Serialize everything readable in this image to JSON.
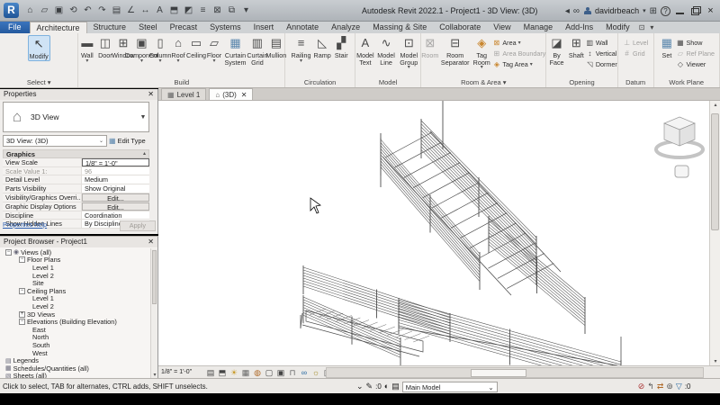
{
  "title_bar": {
    "title": "Autodesk Revit 2022.1 - Project1 - 3D View: (3D)",
    "user": "davidrbeach",
    "qat_icons": [
      "home",
      "open",
      "save",
      "sync-with-central",
      "undo",
      "redo",
      "print",
      "measure",
      "aligned-dimension",
      "text",
      "default-3d-view",
      "section",
      "thin-lines",
      "close-inactive-windows",
      "switch-windows",
      "customize-qat"
    ]
  },
  "ribbon_tabs": {
    "file": "File",
    "tabs": [
      "Architecture",
      "Structure",
      "Steel",
      "Precast",
      "Systems",
      "Insert",
      "Annotate",
      "Analyze",
      "Massing & Site",
      "Collaborate",
      "View",
      "Manage",
      "Add-Ins",
      "Modify"
    ],
    "active": "Architecture"
  },
  "ribbon": {
    "panels": [
      {
        "name": "Select",
        "arrow": true,
        "items": [
          {
            "label": "Modify",
            "icon": "modify-cursor",
            "size": "big",
            "selected": true
          }
        ]
      },
      {
        "name": "Build",
        "items": [
          {
            "label": "Wall",
            "icon": "wall",
            "size": "big",
            "arrow": true
          },
          {
            "label": "Door",
            "icon": "door",
            "size": "big"
          },
          {
            "label": "Window",
            "icon": "window",
            "size": "big"
          },
          {
            "label": "Component",
            "icon": "component",
            "size": "big",
            "arrow": true
          },
          {
            "label": "Column",
            "icon": "column",
            "size": "big",
            "arrow": true
          },
          {
            "label": "Roof",
            "icon": "roof",
            "size": "big",
            "arrow": true
          },
          {
            "label": "Ceiling",
            "icon": "ceiling",
            "size": "big"
          },
          {
            "label": "Floor",
            "icon": "floor",
            "size": "big",
            "arrow": true
          },
          {
            "label": "Curtain System",
            "icon": "curtain-system",
            "size": "big"
          },
          {
            "label": "Curtain Grid",
            "icon": "curtain-grid",
            "size": "big"
          },
          {
            "label": "Mullion",
            "icon": "mullion",
            "size": "big"
          }
        ]
      },
      {
        "name": "Circulation",
        "items": [
          {
            "label": "Railing",
            "icon": "railing",
            "size": "big",
            "arrow": true
          },
          {
            "label": "Ramp",
            "icon": "ramp",
            "size": "big"
          },
          {
            "label": "Stair",
            "icon": "stair",
            "size": "big"
          }
        ]
      },
      {
        "name": "Model",
        "items": [
          {
            "label": "Model Text",
            "icon": "model-text",
            "size": "big"
          },
          {
            "label": "Model Line",
            "icon": "model-line",
            "size": "big"
          },
          {
            "label": "Model Group",
            "icon": "model-group",
            "size": "big",
            "arrow": true
          }
        ]
      },
      {
        "name": "Room & Area",
        "arrow": true,
        "items": [
          {
            "label": "Room",
            "icon": "room",
            "size": "big",
            "disabled": true
          },
          {
            "label": "Room Separator",
            "icon": "room-separator",
            "size": "big"
          },
          {
            "label": "Tag Room",
            "icon": "tag-room",
            "size": "big",
            "arrow": true
          },
          {
            "label": "Area",
            "icon": "area",
            "size": "small",
            "arrow": true
          },
          {
            "label": "Area Boundary",
            "icon": "area-boundary",
            "size": "small",
            "disabled": true
          },
          {
            "label": "Tag Area",
            "icon": "tag-area",
            "size": "small",
            "arrow": true
          }
        ]
      },
      {
        "name": "Opening",
        "items": [
          {
            "label": "By Face",
            "icon": "opening-by-face",
            "size": "big"
          },
          {
            "label": "Shaft",
            "icon": "opening-shaft",
            "size": "big"
          },
          {
            "label": "Wall",
            "icon": "opening-wall",
            "size": "small"
          },
          {
            "label": "Vertical",
            "icon": "opening-vertical",
            "size": "small"
          },
          {
            "label": "Dormer",
            "icon": "opening-dormer",
            "size": "small"
          }
        ]
      },
      {
        "name": "Datum",
        "items": [
          {
            "label": "Level",
            "icon": "level",
            "size": "small",
            "disabled": true
          },
          {
            "label": "Grid",
            "icon": "grid",
            "size": "small",
            "disabled": true
          }
        ]
      },
      {
        "name": "Work Plane",
        "items": [
          {
            "label": "Set",
            "icon": "set-work-plane",
            "size": "big"
          },
          {
            "label": "Show",
            "icon": "show-work-plane",
            "size": "small"
          },
          {
            "label": "Ref Plane",
            "icon": "ref-plane",
            "size": "small",
            "disabled": true
          },
          {
            "label": "Viewer",
            "icon": "viewer",
            "size": "small"
          }
        ]
      }
    ]
  },
  "view_tabs": [
    {
      "label": "Level 1",
      "icon": "floor-plan-view",
      "active": false
    },
    {
      "label": "(3D)",
      "icon": "3d-view",
      "active": true,
      "closable": true
    }
  ],
  "properties": {
    "header": "Properties",
    "type_selector": "3D View",
    "instance_selector": "3D View: (3D)",
    "edit_type": "Edit Type",
    "section": "Graphics",
    "rows": [
      {
        "label": "View Scale",
        "value": "1/8\" = 1'-0\"",
        "style": "input"
      },
      {
        "label": "Scale Value    1:",
        "value": "96",
        "disabled": true
      },
      {
        "label": "Detail Level",
        "value": "Medium"
      },
      {
        "label": "Parts Visibility",
        "value": "Show Original"
      },
      {
        "label": "Visibility/Graphics Overri...",
        "value": "Edit...",
        "style": "button"
      },
      {
        "label": "Graphic Display Options",
        "value": "Edit...",
        "style": "button"
      },
      {
        "label": "Discipline",
        "value": "Coordination"
      },
      {
        "label": "Show Hidden Lines",
        "value": "By Discipline"
      }
    ],
    "help_link": "Properties help",
    "apply_button": "Apply"
  },
  "project_browser": {
    "header": "Project Browser - Project1",
    "tree": [
      {
        "label": "Views (all)",
        "depth": 0,
        "expander": "collapse",
        "icon": "views-search"
      },
      {
        "label": "Floor Plans",
        "depth": 1,
        "expander": "collapse"
      },
      {
        "label": "Level 1",
        "depth": 2
      },
      {
        "label": "Level 2",
        "depth": 2
      },
      {
        "label": "Site",
        "depth": 2
      },
      {
        "label": "Ceiling Plans",
        "depth": 1,
        "expander": "collapse"
      },
      {
        "label": "Level 1",
        "depth": 2
      },
      {
        "label": "Level 2",
        "depth": 2
      },
      {
        "label": "3D Views",
        "depth": 1,
        "expander": "expand"
      },
      {
        "label": "Elevations (Building Elevation)",
        "depth": 1,
        "expander": "collapse"
      },
      {
        "label": "East",
        "depth": 2
      },
      {
        "label": "North",
        "depth": 2
      },
      {
        "label": "South",
        "depth": 2
      },
      {
        "label": "West",
        "depth": 2
      },
      {
        "label": "Legends",
        "depth": 0,
        "icon": "legend"
      },
      {
        "label": "Schedules/Quantities (all)",
        "depth": 0,
        "icon": "schedule"
      },
      {
        "label": "Sheets (all)",
        "depth": 0,
        "icon": "sheet"
      }
    ]
  },
  "view_control_bar": {
    "scale": "1/8\" = 1'-0\"",
    "icons": [
      "detail-level",
      "visual-style",
      "sun-path",
      "shadows",
      "rendering-dialog",
      "crop-view",
      "show-crop-region",
      "unlocked-3d-view",
      "temporary-hide-isolate",
      "reveal-hidden-elements",
      "temporary-view-properties",
      "displacement-sets"
    ]
  },
  "status_bar": {
    "hint": "Click to select, TAB for alternates, CTRL adds, SHIFT unselects.",
    "editable_count": ":0",
    "pre_select_icons": [
      "worksharing-display",
      "active-workset"
    ],
    "design_option": "Main Model",
    "right_icons": [
      "exclude-options",
      "press-and-drag",
      "reveal-constraints",
      "background-processes"
    ],
    "filter_count": ":0"
  }
}
